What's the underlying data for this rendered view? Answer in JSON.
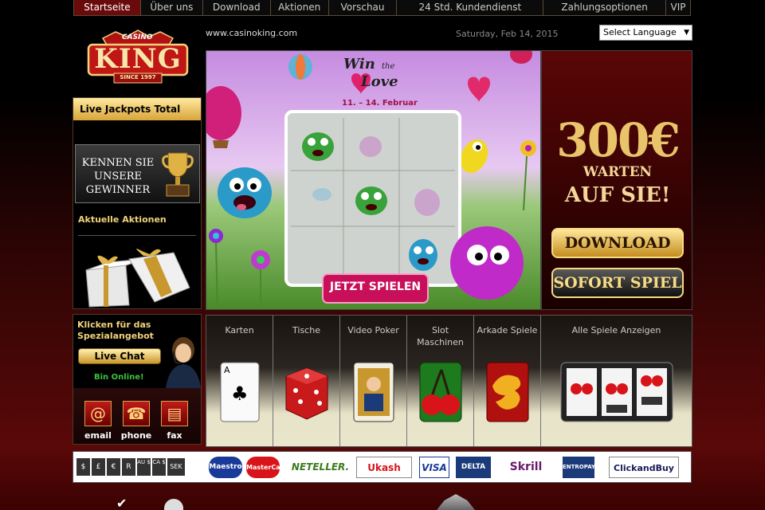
{
  "nav": {
    "items": [
      "Startseite",
      "Über uns",
      "Download",
      "Aktionen",
      "Vorschau",
      "24 Std. Kundendienst",
      "Zahlungsoptionen",
      "VIP"
    ]
  },
  "logo": {
    "top": "CASINO",
    "main": "KING",
    "since": "SINCE 1997"
  },
  "header": {
    "url": "www.casinoking.com",
    "date": "Saturday, Feb 14, 2015",
    "language": "Select Language"
  },
  "left": {
    "jackpots": "Live Jackpots Total",
    "winners": "KENNEN SIE UNSERE GEWINNER",
    "aktionen": "Aktuelle Aktionen"
  },
  "special": {
    "text": "Klicken für das Spezialangebot",
    "chat": "Live Chat",
    "online": "Bin Online!",
    "contacts": [
      "email",
      "phone",
      "fax"
    ]
  },
  "banner": {
    "title_win": "Win",
    "title_the": "the",
    "title_love": "Love",
    "dates": "11. – 14. Februar",
    "cta": "JETZT SPIELEN"
  },
  "promo": {
    "amount": "300€",
    "line1": "WARTEN",
    "line2": "AUF SIE!",
    "download": "DOWNLOAD",
    "sofort": "SOFORT SPIEL"
  },
  "games": {
    "categories": [
      {
        "label": "Karten"
      },
      {
        "label": "Tische"
      },
      {
        "label": "Video Poker"
      },
      {
        "label": "Slot Maschinen"
      },
      {
        "label": "Arkade Spiele"
      },
      {
        "label": "Alle Spiele Anzeigen"
      }
    ]
  },
  "payments": {
    "currencies": [
      "$",
      "£",
      "€",
      "R",
      "AU $",
      "CA $",
      "SEK"
    ],
    "methods": [
      "Maestro",
      "MasterCard",
      "NETELLER.",
      "Ukash",
      "VISA",
      "DELTA",
      "Skrill",
      "ENTROPAY",
      "ClickandBuy"
    ]
  },
  "colors": {
    "accent": "#6a0b0b",
    "gold": "#e9c46a",
    "bg": "#000000"
  }
}
